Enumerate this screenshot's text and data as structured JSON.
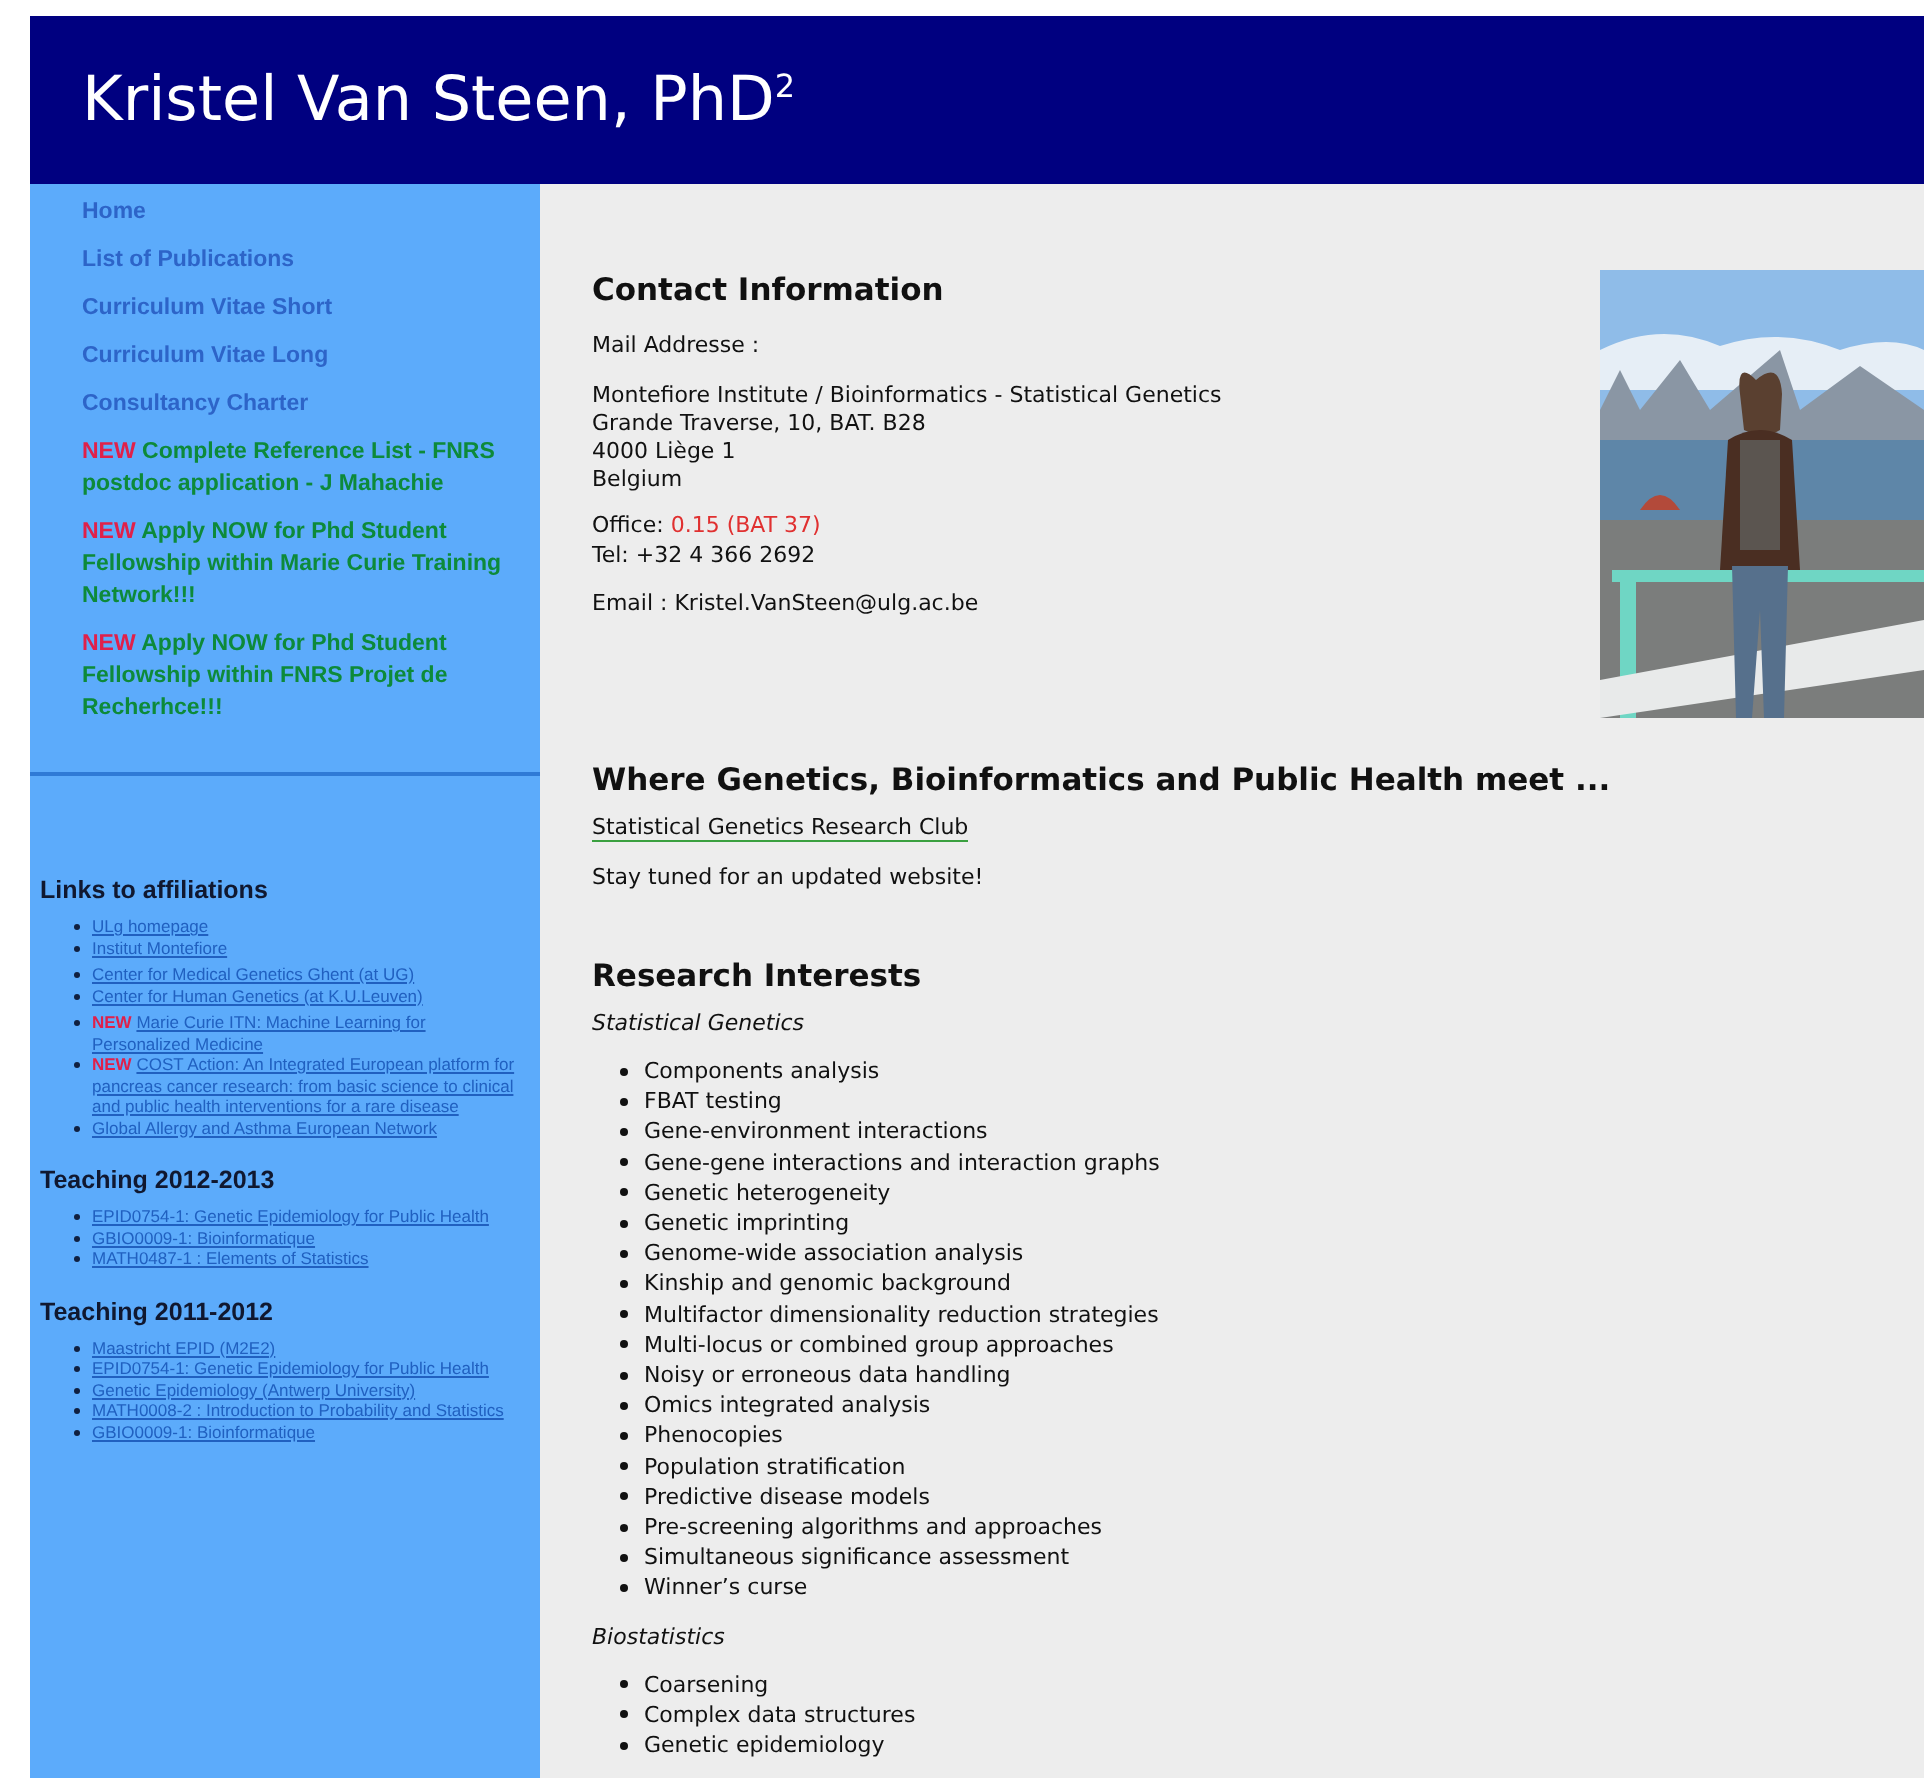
{
  "header": {
    "title": "Kristel Van Steen, PhD$^{2}$"
  },
  "sidebar": {
    "nav": [
      {
        "kind": "link",
        "text": "Home"
      },
      {
        "kind": "link",
        "text": "List of Publications"
      },
      {
        "kind": "link",
        "text": "Curriculum Vitae Short"
      },
      {
        "kind": "link",
        "text": "Curriculum Vitae Long"
      },
      {
        "kind": "link",
        "text": "Consultancy Charter"
      },
      {
        "kind": "new",
        "badge": "NEW",
        "text": "Complete Reference List - FNRS postdoc application - J Mahachie"
      },
      {
        "kind": "new",
        "badge": "NEW",
        "text": "Apply NOW for Phd Student Fellowship within Marie Curie Training Network!!!"
      },
      {
        "kind": "new",
        "badge": "NEW",
        "text": "Apply NOW for Phd Student Fellowship within FNRS Projet de Recherhce!!!"
      }
    ],
    "sections": [
      {
        "title": "Links to affiliations",
        "groups": [
          [
            {
              "text": "ULg homepage"
            },
            {
              "text": "Institut Montefiore"
            }
          ],
          [
            {
              "text": "Center for Medical Genetics Ghent (at UG)"
            },
            {
              "text": "Center for Human Genetics (at K.U.Leuven)"
            }
          ],
          [
            {
              "badge": "NEW",
              "text": "Marie Curie ITN: Machine Learning for Personalized Medicine"
            },
            {
              "badge": "NEW",
              "text": "COST Action: An Integrated European platform for pancreas cancer research: from basic science to clinical and public health interventions for a rare disease"
            },
            {
              "text": "Global Allergy and Asthma European Network"
            }
          ]
        ]
      },
      {
        "title": "Teaching 2012-2013",
        "groups": [
          [
            {
              "text": "EPID0754-1: Genetic Epidemiology for Public Health"
            },
            {
              "text": "GBIO0009-1: Bioinformatique"
            },
            {
              "text": "MATH0487-1 : Elements of Statistics"
            }
          ]
        ]
      },
      {
        "title": "Teaching 2011-2012",
        "groups": [
          [
            {
              "text": "Maastricht EPID (M2E2)"
            },
            {
              "text": "EPID0754-1: Genetic Epidemiology for Public Health"
            },
            {
              "text": "Genetic Epidemiology (Antwerp University)"
            },
            {
              "text": "MATH0008-2 : Introduction to Probability and Statistics"
            },
            {
              "text": "GBIO0009-1: Bioinformatique"
            }
          ]
        ]
      }
    ]
  },
  "contact": {
    "heading": "Contact Information",
    "mail_label": "Mail Addresse :",
    "address": [
      "Montefiore Institute / Bioinformatics - Statistical Genetics",
      "Grande Traverse, 10, BAT. B28",
      "4000 Liège 1",
      "Belgium"
    ],
    "office_label": "Office:",
    "office_value": "0.15 (BAT 37)",
    "tel": "Tel: +32 4 366 2692",
    "email": "Email : Kristel.VanSteen@ulg.ac.be",
    "photo": {
      "kind": "picture"
    }
  },
  "meet": {
    "heading": "Where Genetics, Bioinformatics and Public Health meet ...",
    "link": "Statistical Genetics Research Club",
    "note": "Stay tuned for an updated website!"
  },
  "research": {
    "heading": "Research Interests",
    "groups": [
      {
        "title": "Statistical Genetics",
        "items": [
          "Components analysis",
          "FBAT testing",
          "Gene-environment interactions",
          "Gene-gene interactions and interaction graphs",
          "Genetic heterogeneity",
          "Genetic imprinting",
          "Genome-wide association analysis",
          "Kinship and genomic background",
          "Multifactor dimensionality reduction strategies",
          "Multi-locus or combined group approaches",
          "Noisy or erroneous data handling",
          "Omics integrated analysis",
          "Phenocopies",
          "Population stratification",
          "Predictive disease models",
          "Pre-screening algorithms and approaches",
          "Simultaneous significance assessment",
          "Winner’s curse"
        ]
      },
      {
        "title": "Biostatistics",
        "items": [
          "Coarsening",
          "Complex data structures",
          "Genetic epidemiology"
        ]
      }
    ]
  }
}
